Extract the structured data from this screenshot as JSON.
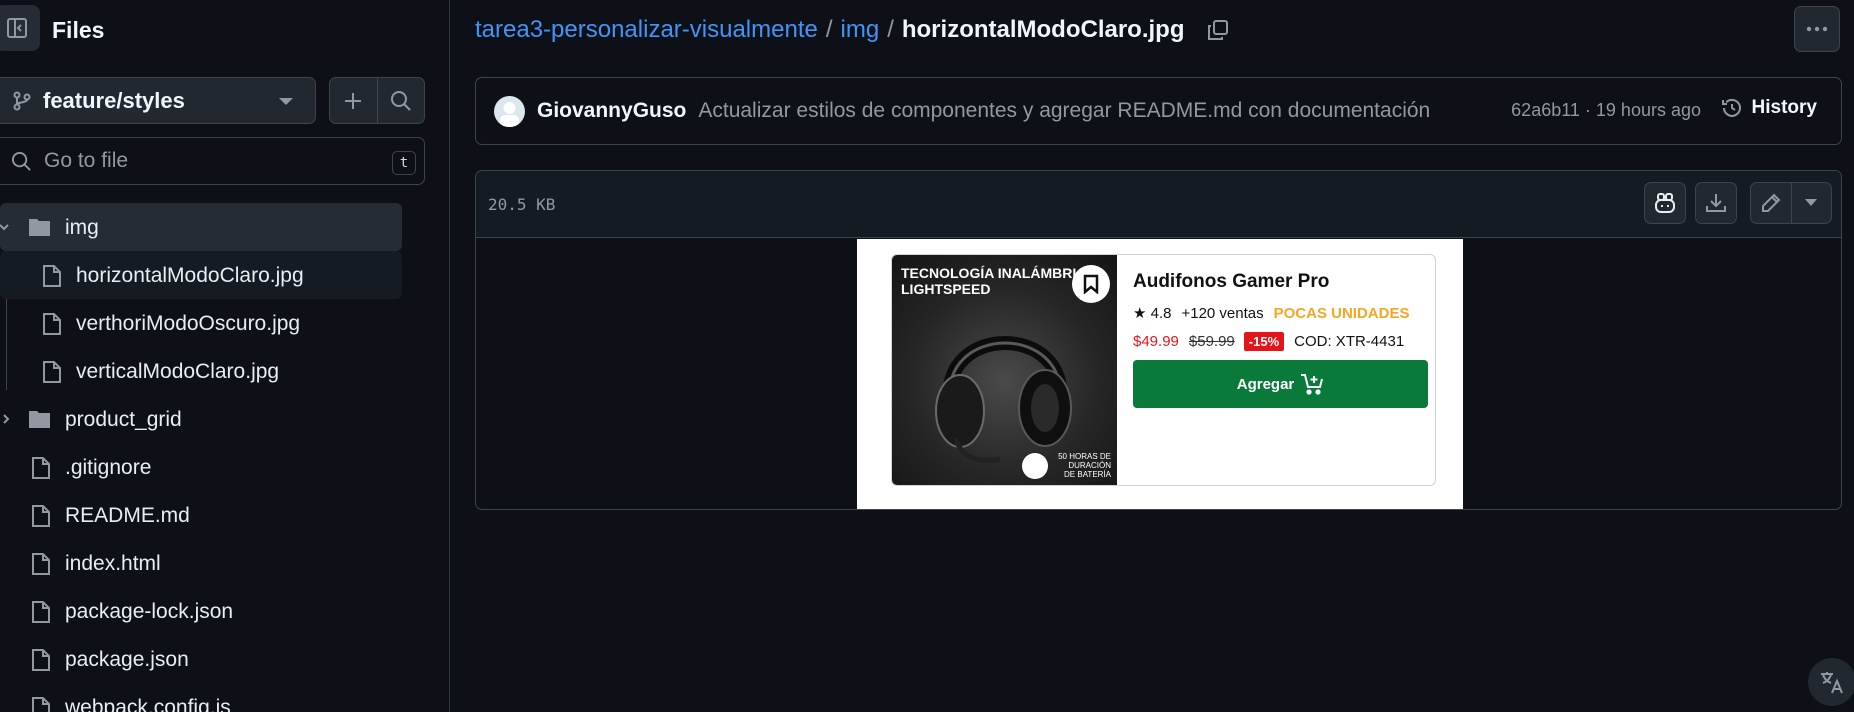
{
  "sidebar": {
    "title": "Files",
    "branch": "feature/styles",
    "goto_placeholder": "Go to file",
    "goto_shortcut": "t",
    "tree": [
      {
        "name": "img",
        "type": "folder",
        "expanded": true
      },
      {
        "name": "horizontalModoClaro.jpg",
        "type": "file",
        "current": true
      },
      {
        "name": "verthoriModoOscuro.jpg",
        "type": "file"
      },
      {
        "name": "verticalModoClaro.jpg",
        "type": "file"
      },
      {
        "name": "product_grid",
        "type": "folder",
        "expanded": false
      },
      {
        "name": ".gitignore",
        "type": "file"
      },
      {
        "name": "README.md",
        "type": "file"
      },
      {
        "name": "index.html",
        "type": "file"
      },
      {
        "name": "package-lock.json",
        "type": "file"
      },
      {
        "name": "package.json",
        "type": "file"
      },
      {
        "name": "webpack.config.js",
        "type": "file"
      }
    ]
  },
  "breadcrumb": {
    "repo": "tarea3-personalizar-visualmente",
    "sep": "/",
    "folder": "img",
    "file": "horizontalModoClaro.jpg"
  },
  "commit": {
    "author": "GiovannyGuso",
    "message": "Actualizar estilos de componentes y agregar README.md con documentación",
    "meta": "62a6b11 · 19 hours ago",
    "history_label": "History"
  },
  "viewer": {
    "file_size": "20.5 KB"
  },
  "product_image": {
    "promo": "TECNOLOGÍA INALÁMBRI\nLIGHTSPEED",
    "battery": "50 HORAS DE\nDURACIÓN\nDE BATERÍA",
    "title": "Audifonos Gamer Pro",
    "rating": "★ 4.8",
    "sold": "+120 ventas",
    "stock": "POCAS UNIDADES",
    "price": "$49.99",
    "old_price": "$59.99",
    "discount": "-15%",
    "code": "COD: XTR-4431",
    "add_label": "Agregar"
  },
  "colors": {
    "accent_link": "#4493f8",
    "background": "#0d1117",
    "add_button": "#0a7a3b",
    "price_red": "#e4141b",
    "stock_orange": "#f5a623"
  }
}
